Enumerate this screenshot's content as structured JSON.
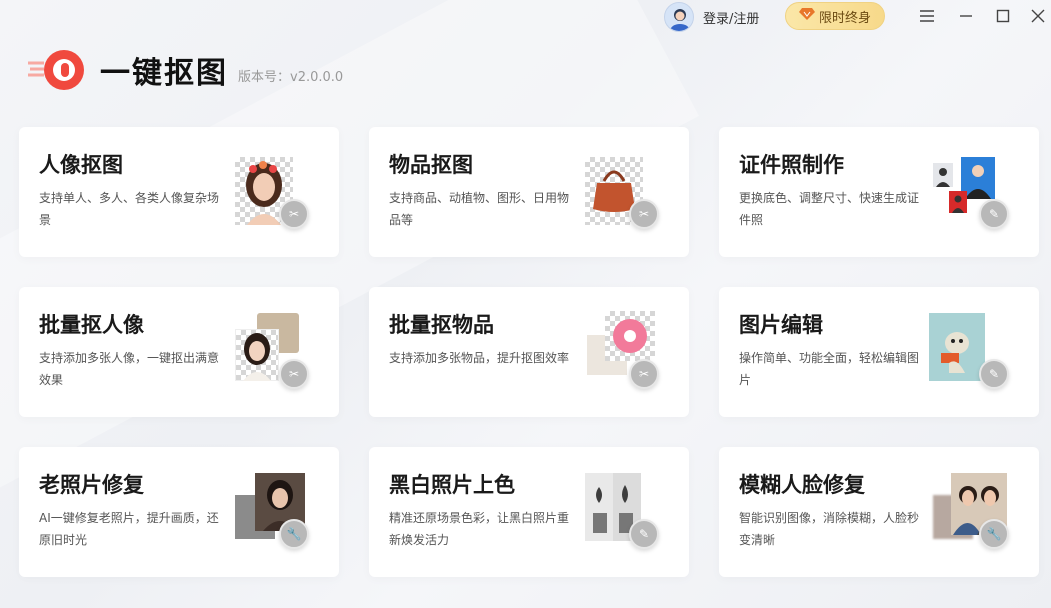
{
  "header": {
    "login_label": "登录/注册",
    "vip_label": "限时终身"
  },
  "app": {
    "name": "一键抠图",
    "version": "版本号：v2.0.0.0"
  },
  "cards": [
    {
      "title": "人像抠图",
      "desc": "支持单人、多人、各类人像复杂场景"
    },
    {
      "title": "物品抠图",
      "desc": "支持商品、动植物、图形、日用物品等"
    },
    {
      "title": "证件照制作",
      "desc": "更换底色、调整尺寸、快速生成证件照"
    },
    {
      "title": "批量抠人像",
      "desc": "支持添加多张人像，一键抠出满意效果"
    },
    {
      "title": "批量抠物品",
      "desc": "支持添加多张物品，提升抠图效率"
    },
    {
      "title": "图片编辑",
      "desc": "操作简单、功能全面，轻松编辑图片"
    },
    {
      "title": "老照片修复",
      "desc": "AI一键修复老照片，提升画质，还原旧时光"
    },
    {
      "title": "黑白照片上色",
      "desc": "精准还原场景色彩，让黑白照片重新焕发活力"
    },
    {
      "title": "模糊人脸修复",
      "desc": "智能识别图像，消除模糊，人脸秒变清晰"
    }
  ],
  "colors": {
    "logo_red": "#f0493e",
    "vip_gold": "#f7d98a"
  }
}
